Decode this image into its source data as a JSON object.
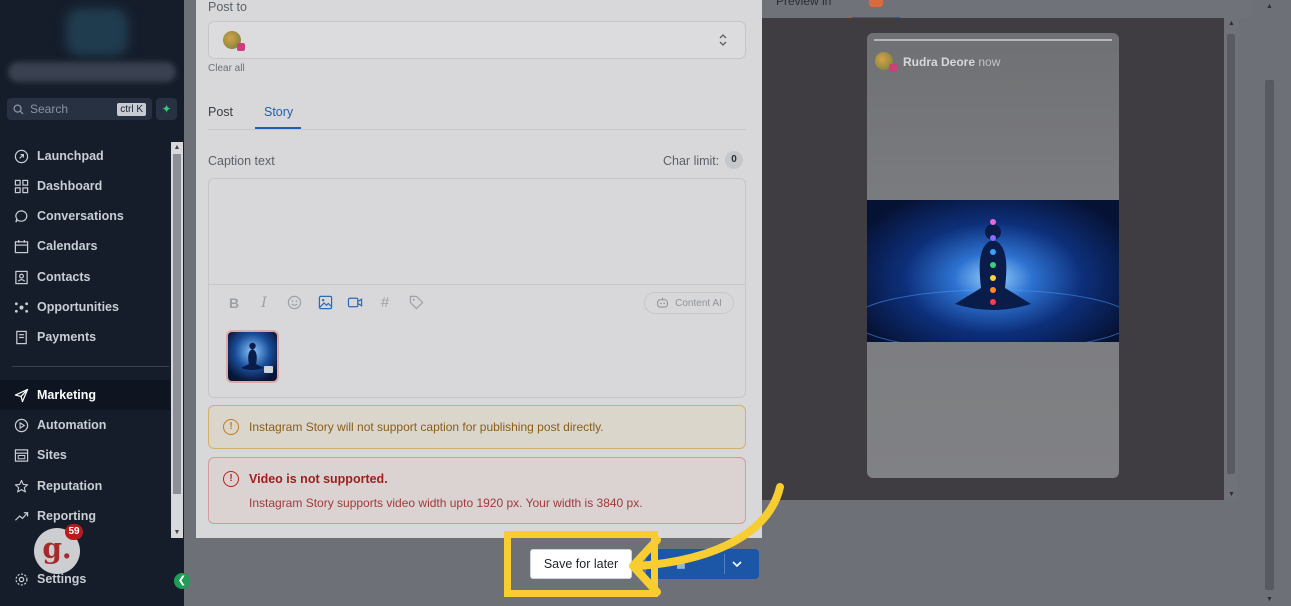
{
  "sidebar": {
    "search_placeholder": "Search",
    "search_shortcut": "ctrl K",
    "quick_action_icon": "lightning-icon",
    "items": [
      {
        "label": "Launchpad",
        "icon": "rocket-icon"
      },
      {
        "label": "Dashboard",
        "icon": "grid-icon"
      },
      {
        "label": "Conversations",
        "icon": "chat-bubble-icon"
      },
      {
        "label": "Calendars",
        "icon": "calendar-icon"
      },
      {
        "label": "Contacts",
        "icon": "contact-card-icon"
      },
      {
        "label": "Opportunities",
        "icon": "pipeline-icon"
      },
      {
        "label": "Payments",
        "icon": "receipt-icon"
      },
      {
        "label": "Marketing",
        "icon": "paper-plane-icon",
        "active": true
      },
      {
        "label": "Automation",
        "icon": "play-circle-icon"
      },
      {
        "label": "Sites",
        "icon": "browser-icon"
      },
      {
        "label": "Reputation",
        "icon": "star-icon"
      },
      {
        "label": "Reporting",
        "icon": "trend-up-icon"
      },
      {
        "label": "Settings",
        "icon": "gear-icon"
      }
    ],
    "notification_count": "59",
    "avatar_letter": "g."
  },
  "composer": {
    "post_to_label": "Post to",
    "clear_all": "Clear all",
    "tabs": [
      {
        "label": "Post",
        "active": false
      },
      {
        "label": "Story",
        "active": true
      }
    ],
    "caption_label": "Caption text",
    "char_limit_label": "Char limit:",
    "char_limit_value": "0",
    "toolbar_icons": [
      "bold-icon",
      "italic-icon",
      "emoji-icon",
      "image-icon",
      "video-icon",
      "hashtag-icon",
      "tag-icon"
    ],
    "content_ai_label": "Content AI",
    "warning_text": "Instagram Story will not support caption for publishing post directly.",
    "error_title": "Video is not supported.",
    "error_detail": "Instagram Story supports video width upto 1920 px. Your width is 3840 px."
  },
  "preview": {
    "heading": "Preview in",
    "user_name": "Rudra Deore",
    "timestamp": "now"
  },
  "actions": {
    "save_for_later": "Save for later"
  },
  "colors": {
    "accent_blue": "#1b56a7",
    "highlight_yellow": "#f8cd32",
    "error_red": "#b3261e",
    "warning_amber": "#c27b1a"
  }
}
